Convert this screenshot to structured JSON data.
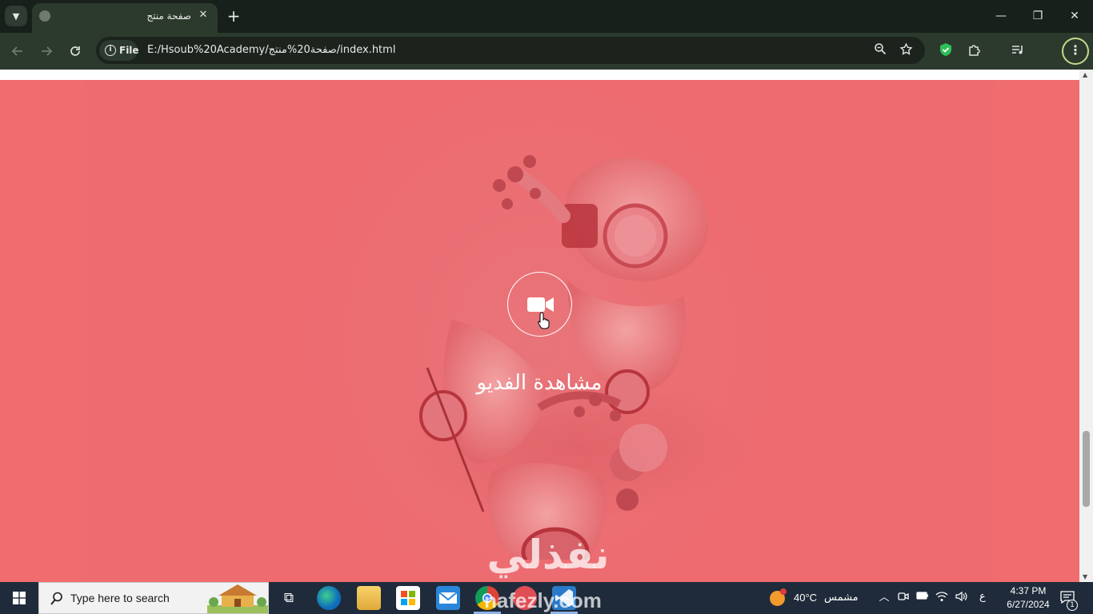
{
  "browser": {
    "tab": {
      "title": "صفحة منتج",
      "close_glyph": "✕"
    },
    "new_tab_glyph": "+",
    "window_controls": {
      "minimize": "—",
      "maximize": "❐",
      "close": "✕"
    },
    "address": {
      "scheme_label": "File",
      "url": "E:/Hsoub%20Academy/صفحة20%منتج/index.html"
    }
  },
  "page": {
    "hero": {
      "video_button_label": "مشاهدة الفديو",
      "background_color": "#f06c6f"
    },
    "watermark_ar": "نفذلي"
  },
  "taskbar": {
    "search_placeholder": "Type here to search",
    "watermark_en": "nafezly.com",
    "weather": {
      "temperature": "40°C",
      "condition": "مشمس"
    },
    "language": "ع",
    "clock": {
      "time": "4:37 PM",
      "date": "6/27/2024"
    },
    "notification_count": "1"
  },
  "icons": {
    "back": "arrow-left-icon",
    "forward": "arrow-right-icon",
    "reload": "reload-icon",
    "zoom": "zoom-icon",
    "bookmark": "star-icon",
    "video": "video-camera-icon"
  }
}
